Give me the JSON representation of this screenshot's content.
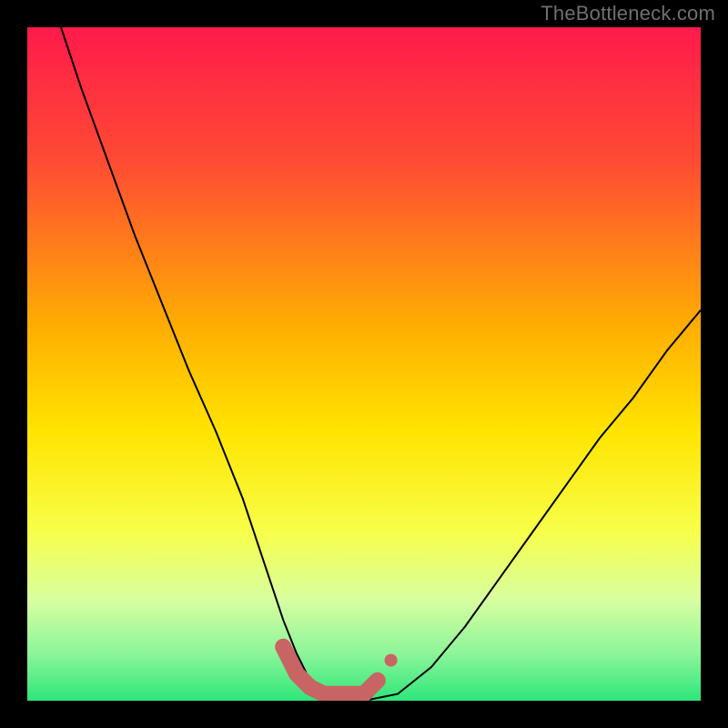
{
  "watermark": "TheBottleneck.com",
  "chart_data": {
    "type": "line",
    "title": "",
    "xlabel": "",
    "ylabel": "",
    "xlim": [
      0,
      100
    ],
    "ylim": [
      0,
      100
    ],
    "gradient_stops": [
      {
        "offset": 0,
        "color": "#ff1a4b"
      },
      {
        "offset": 20,
        "color": "#ff4b33"
      },
      {
        "offset": 45,
        "color": "#ffb000"
      },
      {
        "offset": 60,
        "color": "#ffe400"
      },
      {
        "offset": 75,
        "color": "#f7ff4a"
      },
      {
        "offset": 85,
        "color": "#d8ffa0"
      },
      {
        "offset": 93,
        "color": "#8cf59a"
      },
      {
        "offset": 100,
        "color": "#2ee67a"
      }
    ],
    "series": [
      {
        "name": "bottleneck-curve",
        "x": [
          5,
          8,
          12,
          16,
          20,
          24,
          28,
          32,
          34,
          36,
          38,
          40,
          42,
          44,
          46,
          50,
          55,
          60,
          65,
          70,
          75,
          80,
          85,
          90,
          95,
          100
        ],
        "y": [
          100,
          91,
          80,
          69,
          59,
          49,
          40,
          30,
          24,
          18,
          12,
          7,
          3,
          1,
          0,
          0,
          1,
          5,
          11,
          18,
          25,
          32,
          39,
          45,
          52,
          58
        ]
      }
    ],
    "highlight_segment": {
      "x": [
        38,
        40,
        42,
        44,
        46,
        48,
        50,
        52
      ],
      "y": [
        8,
        4,
        2,
        1,
        1,
        1,
        1,
        3
      ]
    },
    "highlight_dot": {
      "x": 54,
      "y": 6
    }
  }
}
